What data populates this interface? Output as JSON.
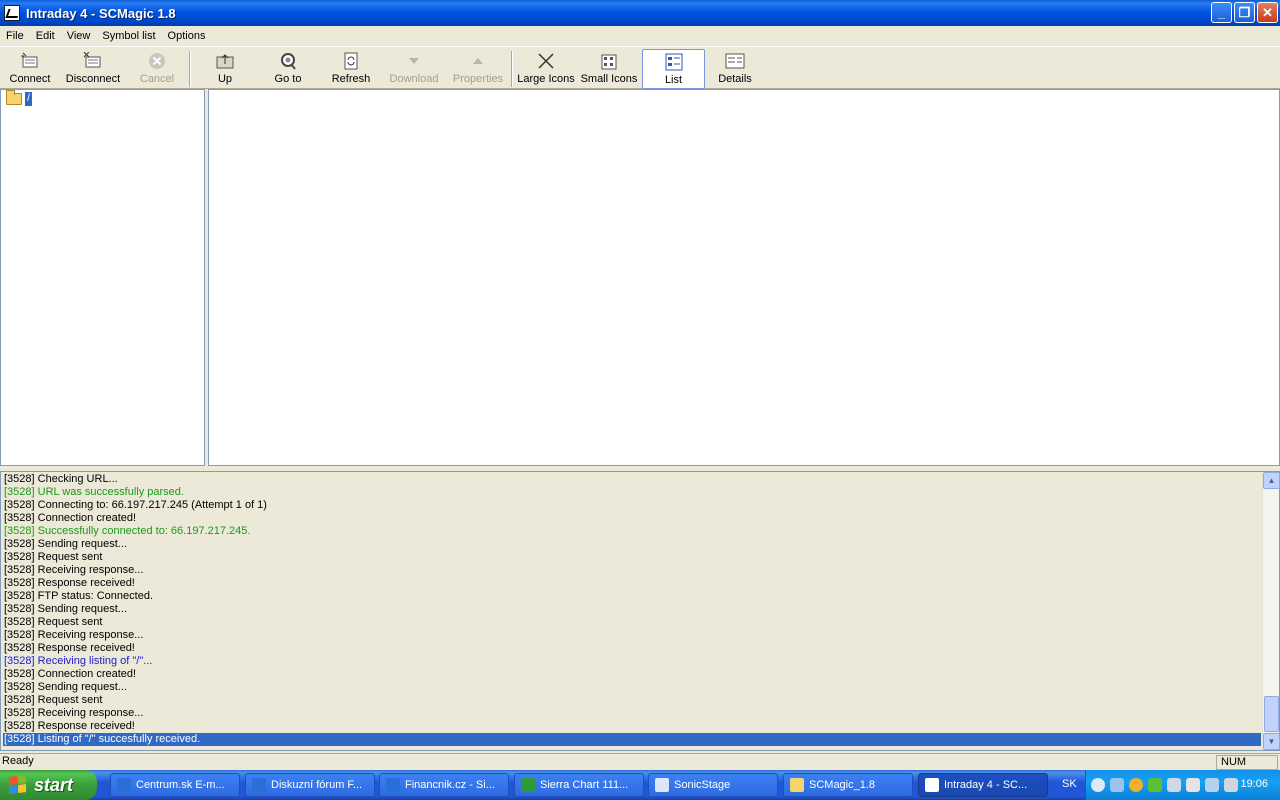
{
  "window": {
    "title": "Intraday 4 - SCMagic 1.8",
    "minimize_glyph": "_",
    "restore_glyph": "❐",
    "close_glyph": "✕"
  },
  "menu": [
    "File",
    "Edit",
    "View",
    "Symbol list",
    "Options"
  ],
  "toolbar": {
    "connect": "Connect",
    "disconnect": "Disconnect",
    "cancel": "Cancel",
    "up": "Up",
    "goto": "Go to",
    "refresh": "Refresh",
    "download": "Download",
    "properties": "Properties",
    "large_icons": "Large Icons",
    "small_icons": "Small Icons",
    "list": "List",
    "details": "Details"
  },
  "tree": {
    "root_label": "/"
  },
  "log": {
    "lines": [
      {
        "text": "[3528] Checking URL...",
        "color": "black"
      },
      {
        "text": "[3528] URL was successfully parsed.",
        "color": "green"
      },
      {
        "text": "[3528] Connecting to: 66.197.217.245 (Attempt 1 of 1)",
        "color": "black"
      },
      {
        "text": "[3528] Connection created!",
        "color": "black"
      },
      {
        "text": "[3528] Successfully connected to: 66.197.217.245.",
        "color": "green"
      },
      {
        "text": "[3528] Sending request...",
        "color": "black"
      },
      {
        "text": "[3528] Request sent",
        "color": "black"
      },
      {
        "text": "[3528] Receiving response...",
        "color": "black"
      },
      {
        "text": "[3528] Response received!",
        "color": "black"
      },
      {
        "text": "[3528] FTP status: Connected.",
        "color": "black"
      },
      {
        "text": "[3528] Sending request...",
        "color": "black"
      },
      {
        "text": "[3528] Request sent",
        "color": "black"
      },
      {
        "text": "[3528] Receiving response...",
        "color": "black"
      },
      {
        "text": "[3528] Response received!",
        "color": "black"
      },
      {
        "text": "[3528] Receiving listing of \"/\"...",
        "color": "blue"
      },
      {
        "text": "[3528] Connection created!",
        "color": "black"
      },
      {
        "text": "[3528] Sending request...",
        "color": "black"
      },
      {
        "text": "[3528] Request sent",
        "color": "black"
      },
      {
        "text": "[3528] Receiving response...",
        "color": "black"
      },
      {
        "text": "[3528] Response received!",
        "color": "black"
      },
      {
        "text": "[3528] Listing of \"/\" succesfully received.",
        "color": "selected"
      }
    ]
  },
  "status": {
    "text": "Ready",
    "num": "NUM"
  },
  "taskbar": {
    "start": "start",
    "tasks": [
      {
        "label": "Centrum.sk E-m...",
        "icon_color": "#2a6fd6"
      },
      {
        "label": "Diskuzní fórum F...",
        "icon_color": "#2a6fd6"
      },
      {
        "label": "Financnik.cz - Si...",
        "icon_color": "#2a6fd6"
      },
      {
        "label": "Sierra Chart 111...",
        "icon_color": "#2f9a3a"
      },
      {
        "label": "SonicStage",
        "icon_color": "#dde6f5"
      },
      {
        "label": "SCMagic_1.8",
        "icon_color": "#f4d46c"
      },
      {
        "label": "Intraday 4 - SC...",
        "icon_color": "#ffffff"
      }
    ],
    "lang": "SK",
    "clock": "19:06"
  }
}
